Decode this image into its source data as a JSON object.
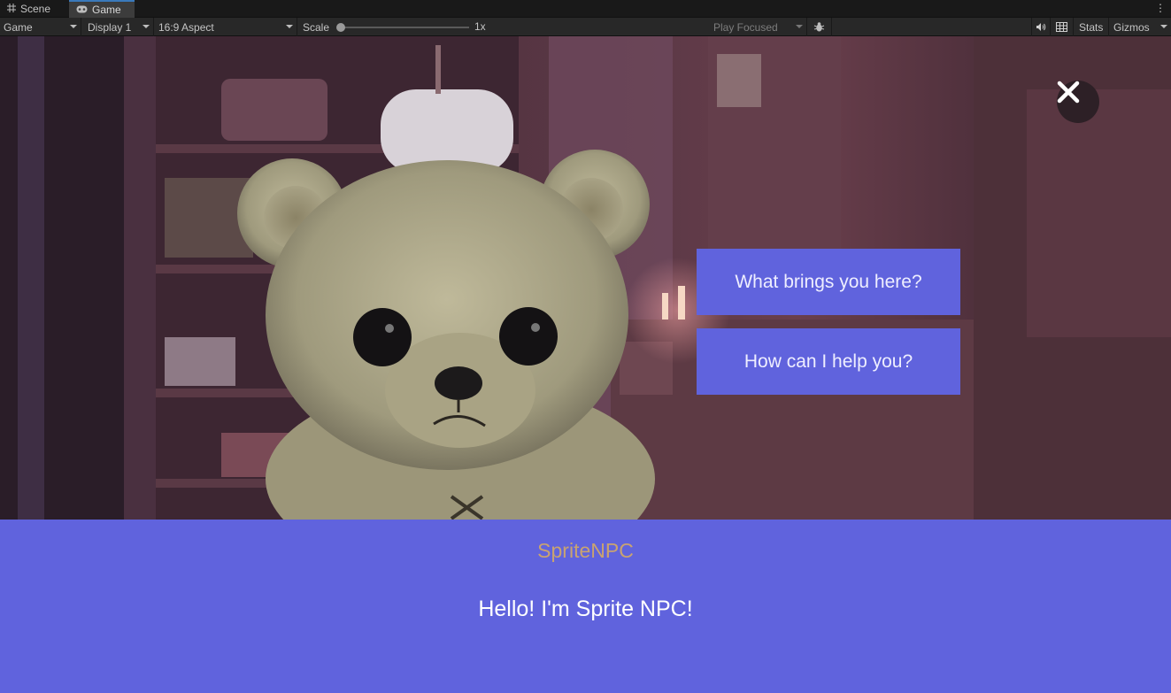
{
  "tabs": [
    {
      "label": "Scene",
      "icon": "grid-icon"
    },
    {
      "label": "Game",
      "icon": "gamepad-icon",
      "active": true
    }
  ],
  "toolbar": {
    "view_mode": "Game",
    "display": "Display 1",
    "aspect": "16:9 Aspect",
    "scale_label": "Scale",
    "scale_value": "1x",
    "play_mode": "Play Focused",
    "stats_label": "Stats",
    "gizmos_label": "Gizmos"
  },
  "game": {
    "npc_name": "SpriteNPC",
    "dialog_text": "Hello! I'm Sprite NPC!",
    "choices": [
      "What brings you here?",
      "How can I help you?"
    ],
    "colors": {
      "dialog_bg": "#6063dd",
      "button_bg": "#6063dd",
      "name_color": "#c9a371"
    }
  }
}
